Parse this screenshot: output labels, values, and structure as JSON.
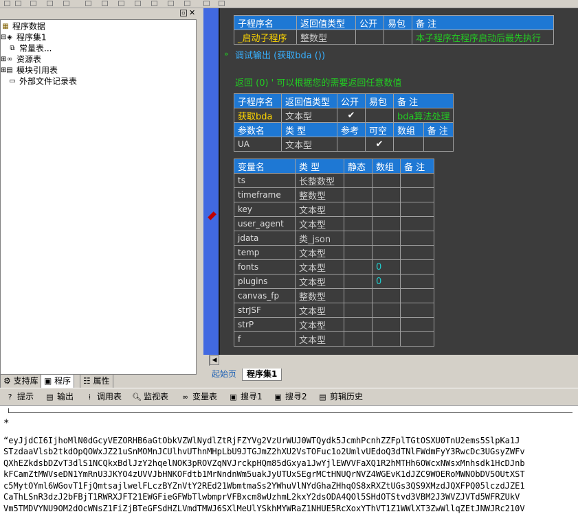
{
  "tree": {
    "root": "程序数据",
    "items": [
      "程序集1",
      "常量表...",
      "资源表",
      "模块引用表",
      "外部文件记录表"
    ]
  },
  "left_tabs": [
    "支持库",
    "程序",
    "属性"
  ],
  "startup_sub": {
    "headers": [
      "子程序名",
      "返回值类型",
      "公开",
      "易包",
      "备 注"
    ],
    "row": {
      "name": "_启动子程序",
      "type": "整数型",
      "public": "",
      "epkg": "",
      "note": "本子程序在程序启动后最先执行"
    }
  },
  "code_lines": {
    "debug": "调试输出 (获取bda ())",
    "ret": "返回 (0)  ' 可以根据您的需要返回任意数值"
  },
  "getbda_sub": {
    "headers": [
      "子程序名",
      "返回值类型",
      "公开",
      "易包",
      "备 注"
    ],
    "row": {
      "name": "获取bda",
      "type": "文本型",
      "public": "✔",
      "epkg": "",
      "note": "bda算法处理"
    },
    "param_headers": [
      "参数名",
      "类 型",
      "参考",
      "可空",
      "数组",
      "备 注"
    ],
    "param_row": {
      "name": "UA",
      "type": "文本型",
      "ref": "",
      "nullable": "✔",
      "array": "",
      "note": ""
    }
  },
  "vars": {
    "headers": [
      "变量名",
      "类 型",
      "静态",
      "数组",
      "备 注"
    ],
    "rows": [
      {
        "name": "ts",
        "type": "长整数型",
        "static": "",
        "array": "",
        "note": ""
      },
      {
        "name": "timeframe",
        "type": "整数型",
        "static": "",
        "array": "",
        "note": ""
      },
      {
        "name": "key",
        "type": "文本型",
        "static": "",
        "array": "",
        "note": ""
      },
      {
        "name": "user_agent",
        "type": "文本型",
        "static": "",
        "array": "",
        "note": ""
      },
      {
        "name": "jdata",
        "type": "类_json",
        "static": "",
        "array": "",
        "note": ""
      },
      {
        "name": "temp",
        "type": "文本型",
        "static": "",
        "array": "",
        "note": ""
      },
      {
        "name": "fonts",
        "type": "文本型",
        "static": "",
        "array": "0",
        "note": ""
      },
      {
        "name": "plugins",
        "type": "文本型",
        "static": "",
        "array": "0",
        "note": ""
      },
      {
        "name": "canvas_fp",
        "type": "整数型",
        "static": "",
        "array": "",
        "note": ""
      },
      {
        "name": "strJSF",
        "type": "文本型",
        "static": "",
        "array": "",
        "note": ""
      },
      {
        "name": "strP",
        "type": "文本型",
        "static": "",
        "array": "",
        "note": ""
      },
      {
        "name": "f",
        "type": "文本型",
        "static": "",
        "array": "",
        "note": ""
      }
    ]
  },
  "editor_tabs": [
    "起始页",
    "程序集1"
  ],
  "bottom_tabs": [
    "提示",
    "输出",
    "调用表",
    "监视表",
    "变量表",
    "搜寻1",
    "搜寻2",
    "剪辑历史"
  ],
  "output": {
    "lines": [
      "*",
      "“eyJjdCI6IjhoMlN0dGcyVEZORHB6aGtObkVZWlNydlZtRjFZYVg2VzUrWUJ0WTQydk5JcmhPcnhZZFplTGtOSXU0TnU2ems5SlpKa1J",
      "STzdaaVlsb2tkdOpQOWxJZ21uSnMOMnJCUlhvUThnMHpLbU9JTGJmZ2hXU2VsTOFuc1o2UmlvUEdoQ3dTNlFWdmFyY3RwcDc3UGsyZWFv",
      "QXhEZkdsbDZvT3dlS1NCQkxBdlJzY2hqelNOK3pROVZqNVJrckpHQm85dGxya1JwYjlEWVVFaXQ1R2hMTHh6OWcxNWsxMnhsdk1HcDJnb",
      "kFCamZtMWVseDN1YmRnU3JKYO4zUVVJbHNKOFdtb1MrNndnWm5uakJyUTUxSEgrMCtHNUQrNVZ4WGEvK1dJZC9WOERoMWNObDV5OUtXST",
      "c5MytOYml6WGovT1FjQmtsajlwelFLczBYZnVtY2REd21WbmtmaSs2YWhuVlNYdGhaZHhqOS8xRXZtUGs3QS9XMzdJQXFPQ05lczdJZE1",
      "CaThLSnR3dzJ2bFBjT1RWRXJFT21EWGFieGFWbTlwbmprVFBxcm8wUzhmL2kxY2dsODA4QOl5SHdOTStvd3VBM2J3WVZJVTd5WFRZUkV",
      "Vm5TMDVYNU9OM2dOcWNsZ1FiZjBTeGFSdHZLVmdTMWJ6SXlMeUlYSkhMYWRaZ1NHUE5RcXoxYThVT1Z1WWlXT3ZwWllqZEtJNWJRc210V"
    ]
  }
}
